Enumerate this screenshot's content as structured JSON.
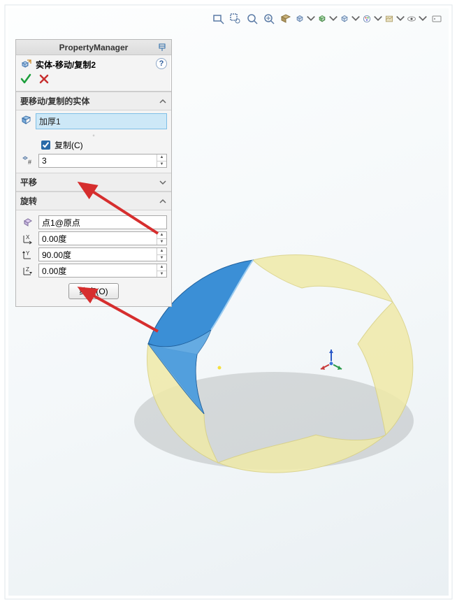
{
  "pm": {
    "title": "PropertyManager",
    "feature_name": "实体-移动/复制2",
    "help_glyph": "?",
    "sections": {
      "bodies": {
        "title": "要移动/复制的实体",
        "selected_body": "加厚1",
        "copy_label": "复制(C)",
        "copy_checked": true,
        "count_value": "3"
      },
      "translate": {
        "title": "平移"
      },
      "rotate": {
        "title": "旋转",
        "ref_point": "点1@原点",
        "x_value": "0.00度",
        "y_value": "90.00度",
        "z_value": "0.00度"
      }
    },
    "constrain_label": "约束(O)"
  },
  "toolbar": {
    "items": [
      "zoom-fit",
      "zoom-area",
      "zoom-prev",
      "zoom-window",
      "section",
      "view-orient",
      "display-style",
      "hide-show",
      "appearance",
      "scene",
      "view-settings",
      "eye",
      "render"
    ]
  }
}
